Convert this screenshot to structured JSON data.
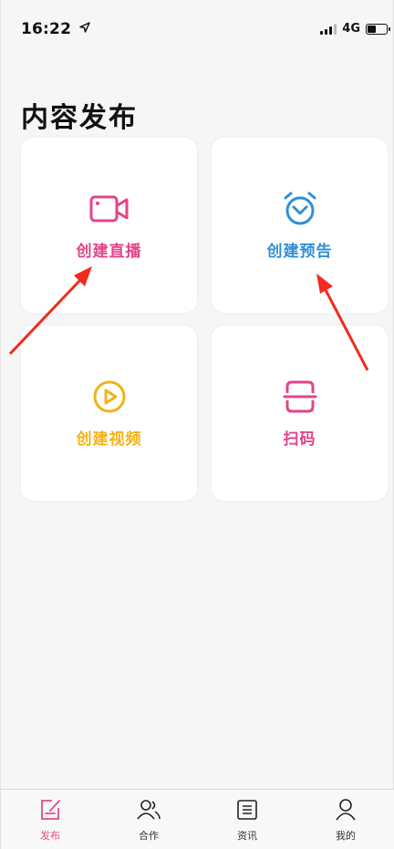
{
  "status_bar": {
    "time": "16:22",
    "network": "4G",
    "battery_level": 0.45
  },
  "page": {
    "title": "内容发布"
  },
  "cards": [
    {
      "label": "创建直播",
      "icon": "video-camera-icon",
      "color": "#e3448a"
    },
    {
      "label": "创建预告",
      "icon": "alarm-clock-icon",
      "color": "#2f8fd8"
    },
    {
      "label": "创建视频",
      "icon": "play-circle-icon",
      "color": "#f2b218"
    },
    {
      "label": "扫码",
      "icon": "scan-icon",
      "color": "#e3448a"
    }
  ],
  "tabbar": {
    "active_color": "#e24a86",
    "items": [
      {
        "label": "发布",
        "icon": "edit-note-icon",
        "active": true
      },
      {
        "label": "合作",
        "icon": "users-icon",
        "active": false
      },
      {
        "label": "资讯",
        "icon": "news-icon",
        "active": false
      },
      {
        "label": "我的",
        "icon": "profile-icon",
        "active": false
      }
    ]
  }
}
